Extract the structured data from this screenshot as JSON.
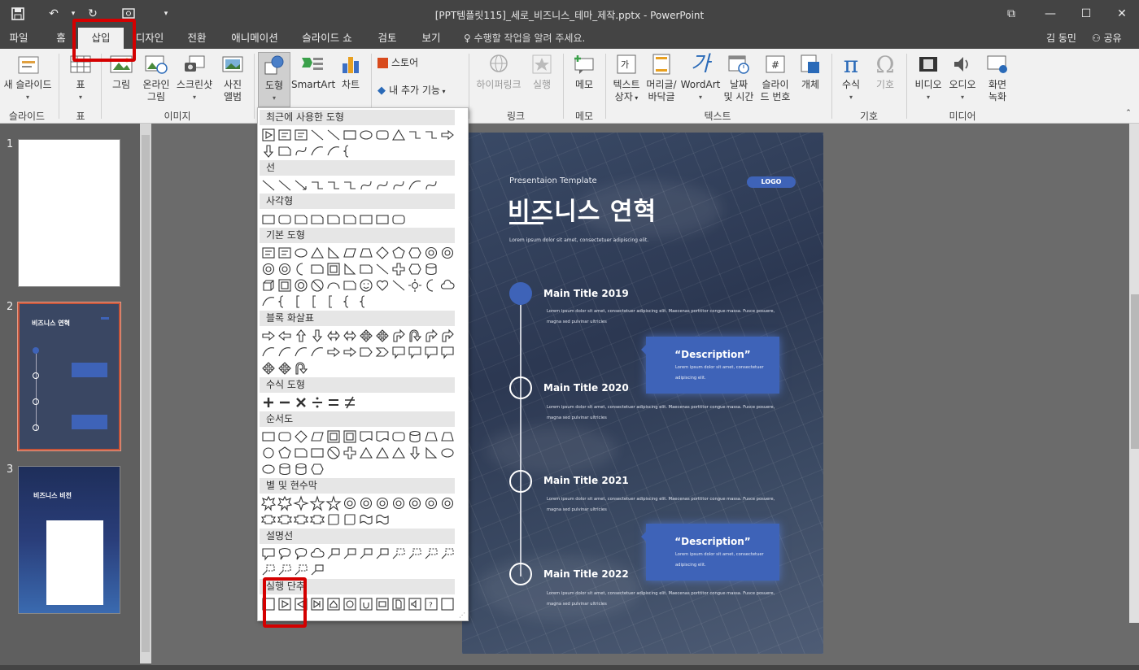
{
  "window": {
    "title": "[PPT템플릿115]_세로_비즈니스_테마_제작.pptx - PowerPoint"
  },
  "tabs": [
    {
      "label": "파일"
    },
    {
      "label": "홈"
    },
    {
      "label": "삽입"
    },
    {
      "label": "디자인"
    },
    {
      "label": "전환"
    },
    {
      "label": "애니메이션"
    },
    {
      "label": "슬라이드 쇼"
    },
    {
      "label": "검토"
    },
    {
      "label": "보기"
    }
  ],
  "tell_me": "수행할 작업을 알려 주세요.",
  "user": "김 동민",
  "share": "공유",
  "ribbon": {
    "new_slide": "새 슬라이드",
    "table": "표",
    "picture": "그림",
    "online_picture_1": "온라인",
    "online_picture_2": "그림",
    "screenshot": "스크린샷",
    "album_1": "사진",
    "album_2": "앨범",
    "shapes": "도형",
    "smartart": "SmartArt",
    "chart": "차트",
    "store": "스토어",
    "my_addins": "내 추가 기능",
    "hyperlink": "하이퍼링크",
    "action": "실행",
    "comment": "메모",
    "textbox_1": "텍스트",
    "textbox_2": "상자",
    "header_1": "머리글/",
    "header_2": "바닥글",
    "wordart": "WordArt",
    "datetime_1": "날짜",
    "datetime_2": "및 시간",
    "slidenum_1": "슬라이",
    "slidenum_2": "드 번호",
    "object": "개체",
    "equation": "수식",
    "symbol": "기호",
    "video": "비디오",
    "audio": "오디오",
    "screenrec_1": "화면",
    "screenrec_2": "녹화",
    "groups": {
      "slides": "슬라이드",
      "tables": "표",
      "images": "이미지",
      "links": "링크",
      "comments": "메모",
      "text": "텍스트",
      "symbols": "기호",
      "media": "미디어"
    }
  },
  "shapes_menu": {
    "sections": [
      "최근에 사용한 도형",
      "선",
      "사각형",
      "기본 도형",
      "블록 화살표",
      "수식 도형",
      "순서도",
      "별 및 현수막",
      "설명선",
      "실행 단추"
    ]
  },
  "thumbnails": [
    {
      "num": "1"
    },
    {
      "num": "2",
      "title": "비즈니스 연혁"
    },
    {
      "num": "3",
      "title": "비즈니스 비전"
    }
  ],
  "slide": {
    "subtitle": "Presentaion Template",
    "logo": "LOGO",
    "title": "비즈니스 연혁",
    "lorem_short": "Lorem ipsum dolor sit amet, consectetuer adipiscing elit.",
    "items": [
      {
        "title": "Main Title 2019"
      },
      {
        "title": "Main Title 2020"
      },
      {
        "title": "Main Title 2021"
      },
      {
        "title": "Main Title 2022"
      }
    ],
    "body_line1": "Lorem ipsum dolor sit amet, consectetuer adipiscing elit. Maecenas porttitor congue massa. Fusce posuere,",
    "body_line2": "magna sed pulvinar ultricies",
    "desc_title": "“Description”",
    "desc_line1": "Lorem ipsum dolor sit amet, consectetuer",
    "desc_line2": "adipiscing elit."
  },
  "colors": {
    "title_bar": "#444444",
    "ribbon": "#f1f1f1",
    "highlight_red": "#d40000",
    "accent_blue": "#3e63b8"
  }
}
